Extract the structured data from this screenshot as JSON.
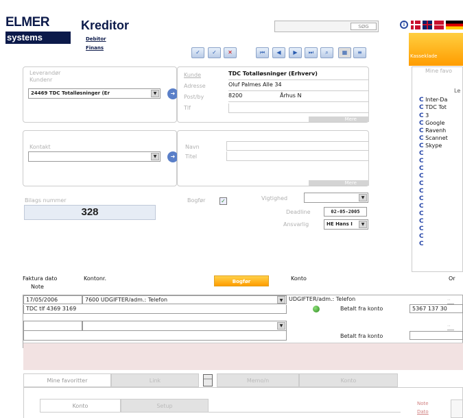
{
  "header": {
    "logo_line1": "ELMER",
    "logo_line2": "systems",
    "title": "Kreditor",
    "nav": [
      "Debitor",
      "Finans"
    ],
    "search_btn": "SØG",
    "info": "i"
  },
  "right_panel": {
    "tab": "Kasseklade",
    "heading": "Mine favo",
    "sub": "Le",
    "items": [
      "Inter-Da",
      "TDC Tot",
      "3",
      "Google",
      "Ravenh",
      "Scannet",
      "Skype",
      "",
      "",
      "",
      "",
      "",
      "",
      "",
      ""
    ]
  },
  "supplier": {
    "label1": "Leverandør",
    "label2": "Kundenr",
    "value": "24469 TDC Totalløsninger (Er",
    "fields": [
      {
        "label": "Kunde",
        "value": "TDC Totalløsninger (Erhverv)"
      },
      {
        "label": "Adresse",
        "value": "Oluf Palmes Alle 34"
      },
      {
        "label": "Post/by",
        "value": "8200",
        "city": "Århus N"
      },
      {
        "label": "Tlf",
        "value": ""
      }
    ],
    "more": "Mere"
  },
  "contact": {
    "label": "Kontakt",
    "fields": [
      {
        "label": "Navn"
      },
      {
        "label": "Titel"
      }
    ],
    "more": "Mere"
  },
  "bilag": {
    "label": "Bilags nummer",
    "value": "328"
  },
  "bogfor": {
    "label": "Bogfør",
    "vigtighed": "Vigtighed",
    "deadline_label": "Deadline",
    "deadline": "02-05-2005",
    "ansvarlig_label": "Ansvarlig",
    "ansvarlig": "HE Hans I"
  },
  "table": {
    "col_faktura": "Faktura dato",
    "col_note": "Note",
    "col_konto": "Kontonr.",
    "button": "Bogfør",
    "col_konto2": "Konto",
    "col_right": "Or",
    "row1": {
      "date": "17/05/2006",
      "konto": "7600 UDGIFTER/adm.: Telefon",
      "konto2": "UDGIFTER/adm.: Telefon"
    },
    "row1_note": "TDC tlf 4369 3169",
    "betalt1": "Betalt fra konto",
    "betalt1_value": "5367 137 30",
    "betalt2": "Betalt fra konto"
  },
  "bottom_tabs": [
    "Mine favoritter",
    "Link",
    "",
    "Memo/n",
    "Konto"
  ],
  "sub_tabs": [
    "Konto",
    "Setup"
  ],
  "bottom_right": [
    "Note",
    "Dato"
  ]
}
